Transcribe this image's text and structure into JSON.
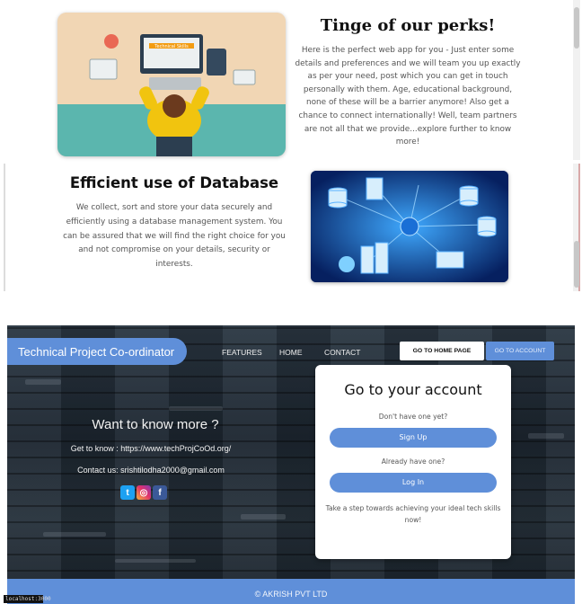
{
  "perks": {
    "title": "Tinge of our perks!",
    "body": "Here is the perfect web app for you - Just enter some details and preferences and we will team you up exactly as per your need, post which you can get in touch personally with them. Age, educational background, none of these will be a barrier anymore! Also get a chance to connect internationally! Well, team partners are not all that we provide...explore further to know more!",
    "image_caption": "Technical Skills"
  },
  "database": {
    "title": "Efficient use of Database",
    "body": "We collect, sort and store your data securely and efficiently using a database management system. You can be assured that we will find the right choice for you and not compromise on your details, security or interests."
  },
  "nav": {
    "brand": "Technical Project Co-ordinator",
    "links": [
      "FEATURES",
      "HOME",
      "CONTACT"
    ],
    "home_button": "GO TO HOME PAGE",
    "account_button": "GO TO ACCOUNT"
  },
  "info": {
    "title": "Want to know more ?",
    "get_to_know": "Get to know : https://www.techProjCoOd.org/",
    "contact": "Contact us: srishtilodha2000@gmail.com"
  },
  "account_card": {
    "title": "Go to your account",
    "no_account": "Don't have one yet?",
    "signup": "Sign Up",
    "have_account": "Already have one?",
    "login": "Log In",
    "tagline": "Take a step towards achieving your ideal tech skills now!"
  },
  "footer": {
    "copyright": "© AKRISH PVT LTD",
    "status": "localhost:3000"
  },
  "colors": {
    "accent": "#5f8fd9",
    "dark_bg": "#1f2933"
  }
}
